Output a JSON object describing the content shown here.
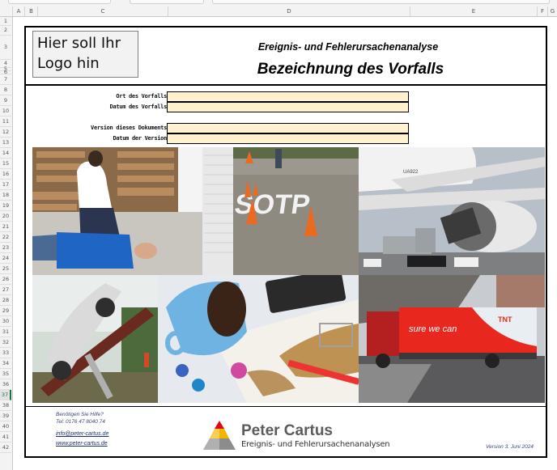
{
  "spreadsheet": {
    "columns": [
      "A",
      "B",
      "C",
      "D",
      "E",
      "F",
      "G"
    ],
    "rows": [
      "1",
      "2",
      "3",
      "4",
      "5",
      "6",
      "7",
      "8",
      "9",
      "10",
      "11",
      "12",
      "13",
      "14",
      "15",
      "16",
      "17",
      "18",
      "19",
      "20",
      "21",
      "22",
      "23",
      "24",
      "25",
      "26",
      "27",
      "28",
      "29",
      "30",
      "31",
      "32",
      "33",
      "34",
      "35",
      "36",
      "37",
      "38",
      "39",
      "40",
      "41",
      "42"
    ],
    "active_row": "37"
  },
  "header": {
    "logo_placeholder_line1": "Hier soll Ihr",
    "logo_placeholder_line2": "Logo hin",
    "subtitle": "Ereignis- und Fehlerursachenanalyse",
    "title": "Bezeichnung des Vorfalls"
  },
  "fields": [
    {
      "label": "Ort des Vorfalls",
      "value": ""
    },
    {
      "label": "Datum des Vorfalls",
      "value": ""
    },
    {
      "label": "Version dieses Dokuments",
      "value": ""
    },
    {
      "label": "Datum der Version",
      "value": ""
    }
  ],
  "photos": [
    {
      "name": "first-aid-photo",
      "description": "Woman on phone kneeling beside man lying on floor"
    },
    {
      "name": "stop-marking-photo",
      "description": "Road marking misspelled SOTP with traffic cones"
    },
    {
      "name": "airplane-engine-photo",
      "description": "Cargo container stuck in airplane engine"
    },
    {
      "name": "car-lift-photo",
      "description": "Car tilted on collapsed lift"
    },
    {
      "name": "coffee-spill-photo",
      "description": "Coffee mug spilled over documents with calculator and glasses"
    },
    {
      "name": "truck-bridge-photo",
      "description": "TNT truck stuck under bridge",
      "truck_slogan": "sure we can",
      "truck_brand": "TNT"
    }
  ],
  "footer": {
    "help_text": "Benötigen Sie Hilfe?",
    "phone": "Tel: 0176 47 8040 74",
    "email": "info@peter-cartus.de",
    "website": "www.peter-cartus.de",
    "brand_name": "Peter Cartus",
    "brand_tagline": "Ereignis- und Fehlerursachenanalysen",
    "version": "Version 3. Juni 2024"
  },
  "colors": {
    "input_fill": "#fff2cc",
    "footer_text": "#3a4a7a",
    "pyramid_top": "#e30613",
    "pyramid_mid": "#f2b600",
    "pyramid_base": "#8c8c8c"
  }
}
